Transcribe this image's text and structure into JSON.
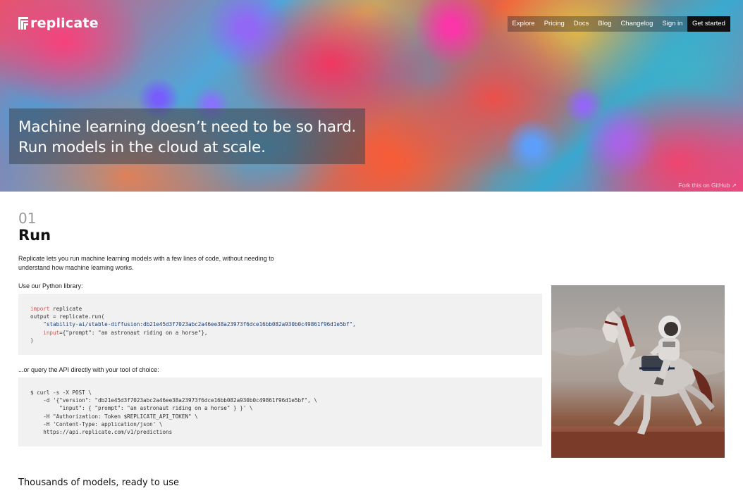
{
  "brand": {
    "name": "replicate"
  },
  "nav": {
    "items": [
      "Explore",
      "Pricing",
      "Docs",
      "Blog",
      "Changelog",
      "Sign in"
    ],
    "cta": "Get started"
  },
  "hero": {
    "line1": "Machine learning doesn’t need to be so hard.",
    "line2": "Run models in the cloud at scale.",
    "fork_link": "Fork this on GitHub ↗"
  },
  "run_section": {
    "number": "01",
    "title": "Run",
    "intro": "Replicate lets you run machine learning models with a few lines of code, without needing to understand how machine learning works.",
    "python_label": "Use our Python library:",
    "python_code": {
      "l1_kw": "import",
      "l1_rest": " replicate",
      "l2": "output = replicate.run(",
      "l3": "    \"stability-ai/stable-diffusion:db21e45d3f7023abc2a46ee38a23973f6dce16bb082a930b0c49861f96d1e5bf\",",
      "l4_arg": "    input",
      "l4_rest": "={\"prompt\": \"an astronaut riding on a horse\"},",
      "l5": ")"
    },
    "api_label": "...or query the API directly with your tool of choice:",
    "curl_code": [
      "$ curl -s -X POST \\",
      "    -d '{\"version\": \"db21e45d3f7023abc2a46ee38a23973f6dce16bb082a930b0c49861f96d1e5bf\", \\",
      "         \"input\": { \"prompt\": \"an astronaut riding on a horse\" } }' \\",
      "    -H \"Authorization: Token $REPLICATE_API_TOKEN\" \\",
      "    -H 'Content-Type: application/json' \\",
      "    https://api.replicate.com/v1/predictions"
    ]
  },
  "models_section": {
    "title": "Thousands of models, ready to use"
  },
  "icons": {
    "logo": "replicate-logo-icon",
    "image": "astronaut-horse-image"
  }
}
